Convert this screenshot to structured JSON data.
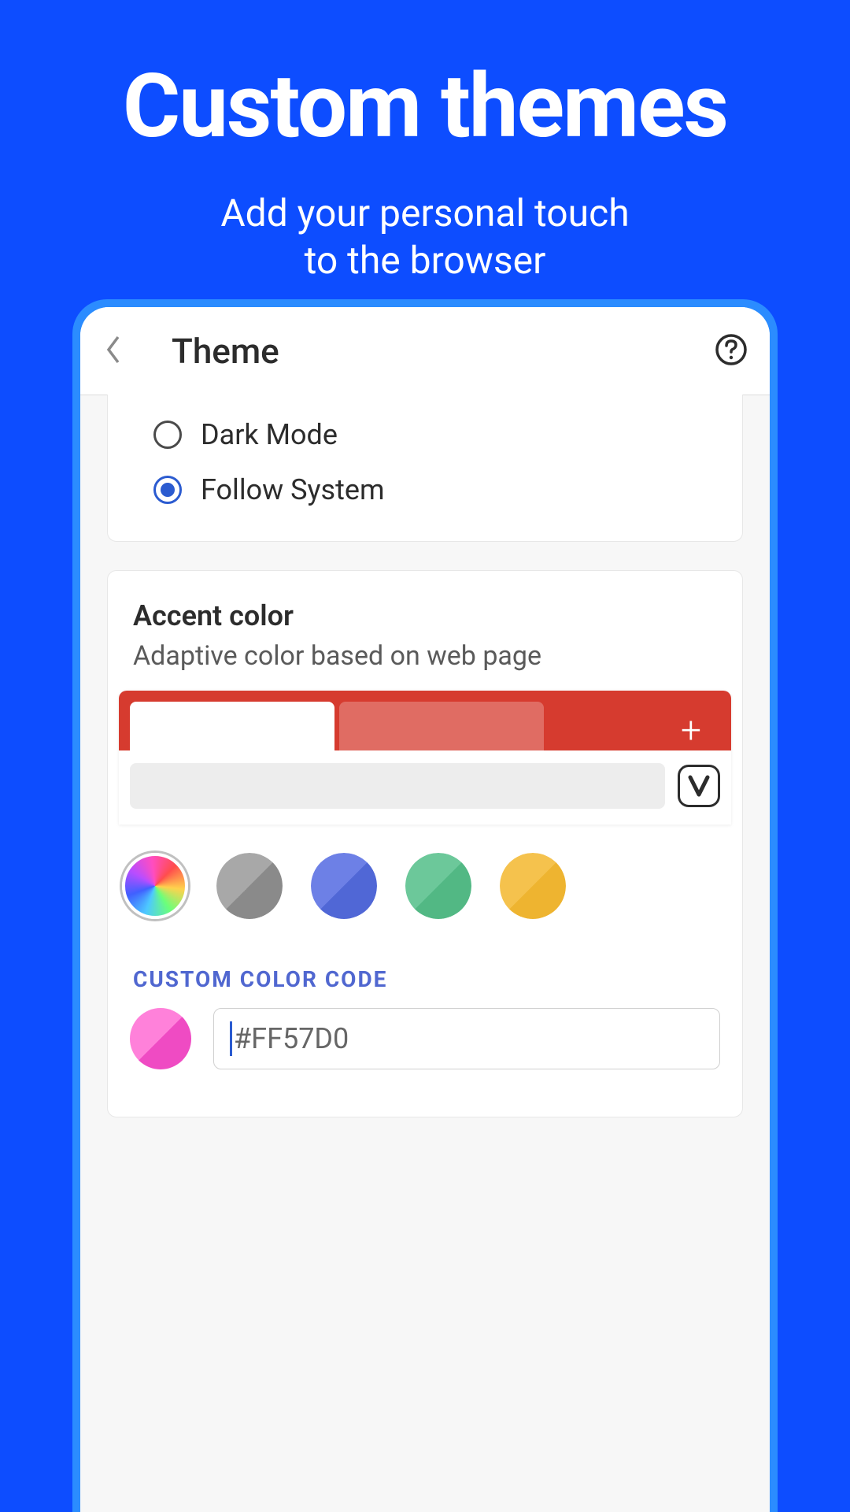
{
  "hero": {
    "title": "Custom themes",
    "subtitle_line1": "Add your personal touch",
    "subtitle_line2": "to the browser"
  },
  "header": {
    "title": "Theme"
  },
  "modes": {
    "dark_label": "Dark Mode",
    "follow_label": "Follow System"
  },
  "accent": {
    "title": "Accent color",
    "subtitle": "Adaptive color based on web page"
  },
  "swatches": {
    "grey": {
      "light": "#a8a8a8",
      "dark": "#8a8a8a"
    },
    "blue": {
      "light": "#6d80e6",
      "dark": "#5067d6"
    },
    "green": {
      "light": "#6cc89a",
      "dark": "#52b884"
    },
    "yellow": {
      "light": "#f5c24d",
      "dark": "#eeb430"
    }
  },
  "custom": {
    "label": "CUSTOM COLOR CODE",
    "value": "#FF57D0",
    "preview_light": "#ff81da",
    "preview_dark": "#ef4bc3"
  }
}
